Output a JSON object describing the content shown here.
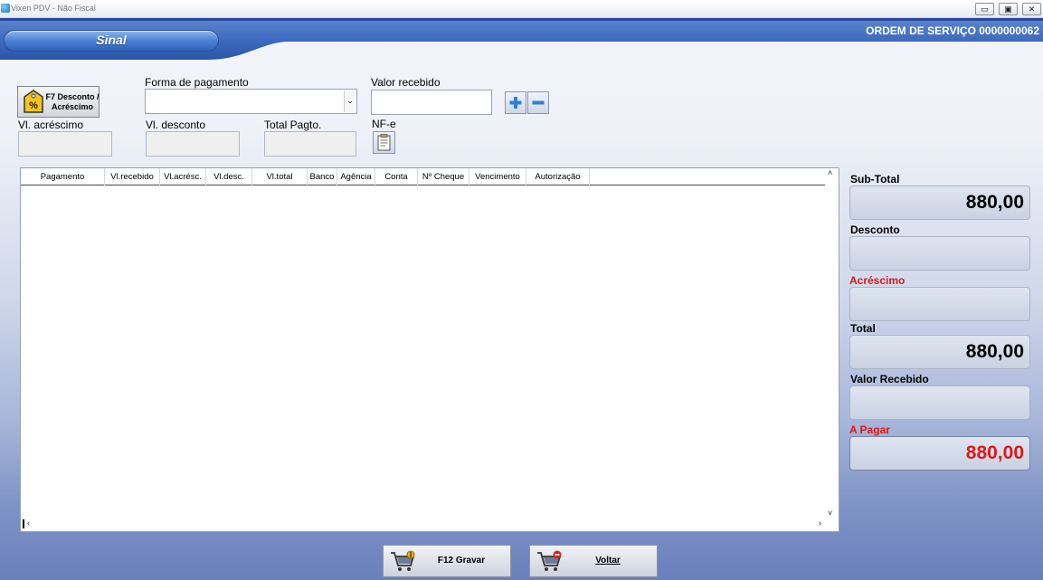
{
  "window": {
    "title": "Vixen PDV - Não Fiscal",
    "minimize": "▭",
    "maximize": "▣",
    "close": "✕"
  },
  "header": {
    "title": "Sinal",
    "order_number": "ORDEM DE SERVIÇO 0000000062"
  },
  "form": {
    "discount_button": "F7 Desconto / Acréscimo",
    "payment_method_label": "Forma de pagamento",
    "payment_method_value": "",
    "amount_received_label": "Valor recebido",
    "amount_received_value": "",
    "surcharge_label": "Vl. acréscimo",
    "surcharge_value": "",
    "discount_label": "Vl. desconto",
    "discount_value": "",
    "total_payment_label": "Total Pagto.",
    "total_payment_value": "",
    "nfe_label": "NF-e"
  },
  "grid": {
    "columns": [
      "Pagamento",
      "Vl.recebido",
      "Vl.acrésc.",
      "Vl.desc.",
      "Vl.total",
      "Banco",
      "Agência",
      "Conta",
      "Nº Cheque",
      "Vencimento",
      "Autorização"
    ],
    "rows": []
  },
  "totals": {
    "subtotal_label": "Sub-Total",
    "subtotal_value": "880,00",
    "discount_label": "Desconto",
    "discount_value": "",
    "surcharge_label": "Acréscimo",
    "surcharge_value": "",
    "total_label": "Total",
    "total_value": "880,00",
    "received_label": "Valor Recebido",
    "received_value": "",
    "to_pay_label": "A Pagar",
    "to_pay_value": "880,00"
  },
  "buttons": {
    "save": "F12 Gravar",
    "back": "Voltar"
  },
  "colors": {
    "accent_red": "#e01818",
    "header_blue": "#2f62b8"
  }
}
